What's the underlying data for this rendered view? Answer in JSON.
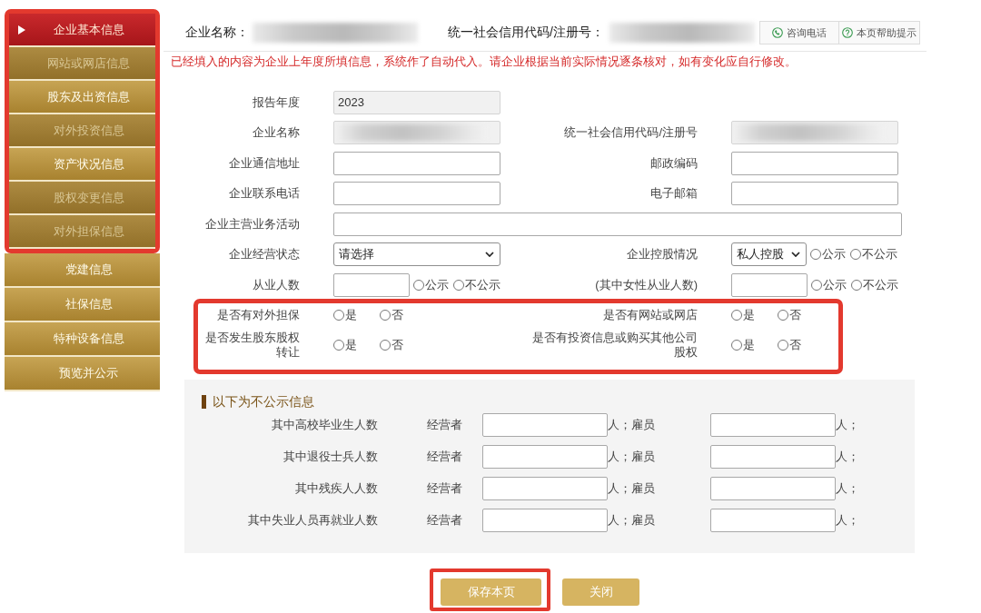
{
  "sidebar": {
    "groups": [
      {
        "highlighted": true,
        "items": [
          {
            "label": "企业基本信息",
            "selected": true,
            "disabled": false
          },
          {
            "label": "网站或网店信息",
            "selected": false,
            "disabled": true
          },
          {
            "label": "股东及出资信息",
            "selected": false,
            "disabled": false
          },
          {
            "label": "对外投资信息",
            "selected": false,
            "disabled": true
          },
          {
            "label": "资产状况信息",
            "selected": false,
            "disabled": false
          },
          {
            "label": "股权变更信息",
            "selected": false,
            "disabled": true
          },
          {
            "label": "对外担保信息",
            "selected": false,
            "disabled": true
          }
        ]
      },
      {
        "highlighted": false,
        "items": [
          {
            "label": "党建信息",
            "selected": false,
            "disabled": false
          },
          {
            "label": "社保信息",
            "selected": false,
            "disabled": false
          },
          {
            "label": "特种设备信息",
            "selected": false,
            "disabled": false
          },
          {
            "label": "预览并公示",
            "selected": false,
            "disabled": false
          }
        ]
      }
    ]
  },
  "header": {
    "fields": [
      {
        "label": "企业名称：",
        "kind": "blurred"
      },
      {
        "label": "统一社会信用代码/注册号：",
        "kind": "blurred"
      }
    ],
    "buttons": [
      {
        "label": "咨询电话"
      },
      {
        "label": "本页帮助提示"
      }
    ]
  },
  "notice": "已经填入的内容为企业上年度所填信息，系统作了自动代入。请企业根据当前实际情况逐条核对，如有变化应自行修改。",
  "form": {
    "rows": [
      {
        "cells": [
          {
            "label": "报告年度",
            "field": {
              "kind": "text",
              "value": "2023",
              "readonly": true
            }
          }
        ]
      },
      {
        "cells": [
          {
            "label": "企业名称",
            "field": {
              "kind": "blurred"
            }
          },
          {
            "label": "统一社会信用代码/注册号",
            "field": {
              "kind": "blurred"
            }
          }
        ]
      },
      {
        "cells": [
          {
            "label": "企业通信地址",
            "field": {
              "kind": "text",
              "readonly": false
            }
          },
          {
            "label": "邮政编码",
            "field": {
              "kind": "text",
              "readonly": false
            }
          }
        ]
      },
      {
        "cells": [
          {
            "label": "企业联系电话",
            "field": {
              "kind": "text",
              "readonly": false
            }
          },
          {
            "label": "电子邮箱",
            "field": {
              "kind": "text",
              "readonly": false
            }
          }
        ]
      },
      {
        "cells": [
          {
            "label": "企业主营业务活动",
            "field": {
              "kind": "long_text",
              "readonly": false
            }
          }
        ]
      },
      {
        "cells": [
          {
            "label": "企业经营状态",
            "field": {
              "kind": "select",
              "value": "请选择"
            }
          },
          {
            "label": "企业控股情况",
            "field": {
              "kind": "select",
              "value": "私人控股"
            },
            "publicity": [
              {
                "label": "公示",
                "selected": false
              },
              {
                "label": "不公示",
                "selected": false
              }
            ]
          }
        ]
      },
      {
        "cells": [
          {
            "label": "从业人数",
            "field": {
              "kind": "text",
              "readonly": false
            },
            "publicity": [
              {
                "label": "公示",
                "selected": false
              },
              {
                "label": "不公示",
                "selected": false
              }
            ]
          },
          {
            "label": "(其中女性从业人数)",
            "field": {
              "kind": "text",
              "readonly": false
            },
            "publicity": [
              {
                "label": "公示",
                "selected": false
              },
              {
                "label": "不公示",
                "selected": false
              }
            ]
          }
        ]
      }
    ]
  },
  "questions": {
    "highlighted": true,
    "rows": [
      {
        "cells": [
          {
            "label": "是否有对外担保",
            "options": [
              {
                "label": "是",
                "selected": false
              },
              {
                "label": "否",
                "selected": false
              }
            ]
          },
          {
            "label": "是否有网站或网店",
            "options": [
              {
                "label": "是",
                "selected": false
              },
              {
                "label": "否",
                "selected": false
              }
            ]
          }
        ]
      },
      {
        "cells": [
          {
            "label": "是否发生股东股权转让",
            "options": [
              {
                "label": "是",
                "selected": false
              },
              {
                "label": "否",
                "selected": false
              }
            ]
          },
          {
            "label": "是否有投资信息或购买其他公司股权",
            "options": [
              {
                "label": "是",
                "selected": false
              },
              {
                "label": "否",
                "selected": false
              }
            ]
          }
        ]
      }
    ]
  },
  "non_public": {
    "title": "以下为不公示信息",
    "rows": [
      {
        "label": "其中高校毕业生人数",
        "operator_label": "经营者",
        "operator_unit": "人；",
        "employee_label": "雇员",
        "employee_unit": "人；"
      },
      {
        "label": "其中退役士兵人数",
        "operator_label": "经营者",
        "operator_unit": "人；",
        "employee_label": "雇员",
        "employee_unit": "人；"
      },
      {
        "label": "其中残疾人人数",
        "operator_label": "经营者",
        "operator_unit": "人；",
        "employee_label": "雇员",
        "employee_unit": "人；"
      },
      {
        "label": "其中失业人员再就业人数",
        "operator_label": "经营者",
        "operator_unit": "人；",
        "employee_label": "雇员",
        "employee_unit": "人；"
      }
    ]
  },
  "buttons": [
    {
      "label": "保存本页",
      "highlighted": true
    },
    {
      "label": "关闭",
      "highlighted": false
    }
  ]
}
